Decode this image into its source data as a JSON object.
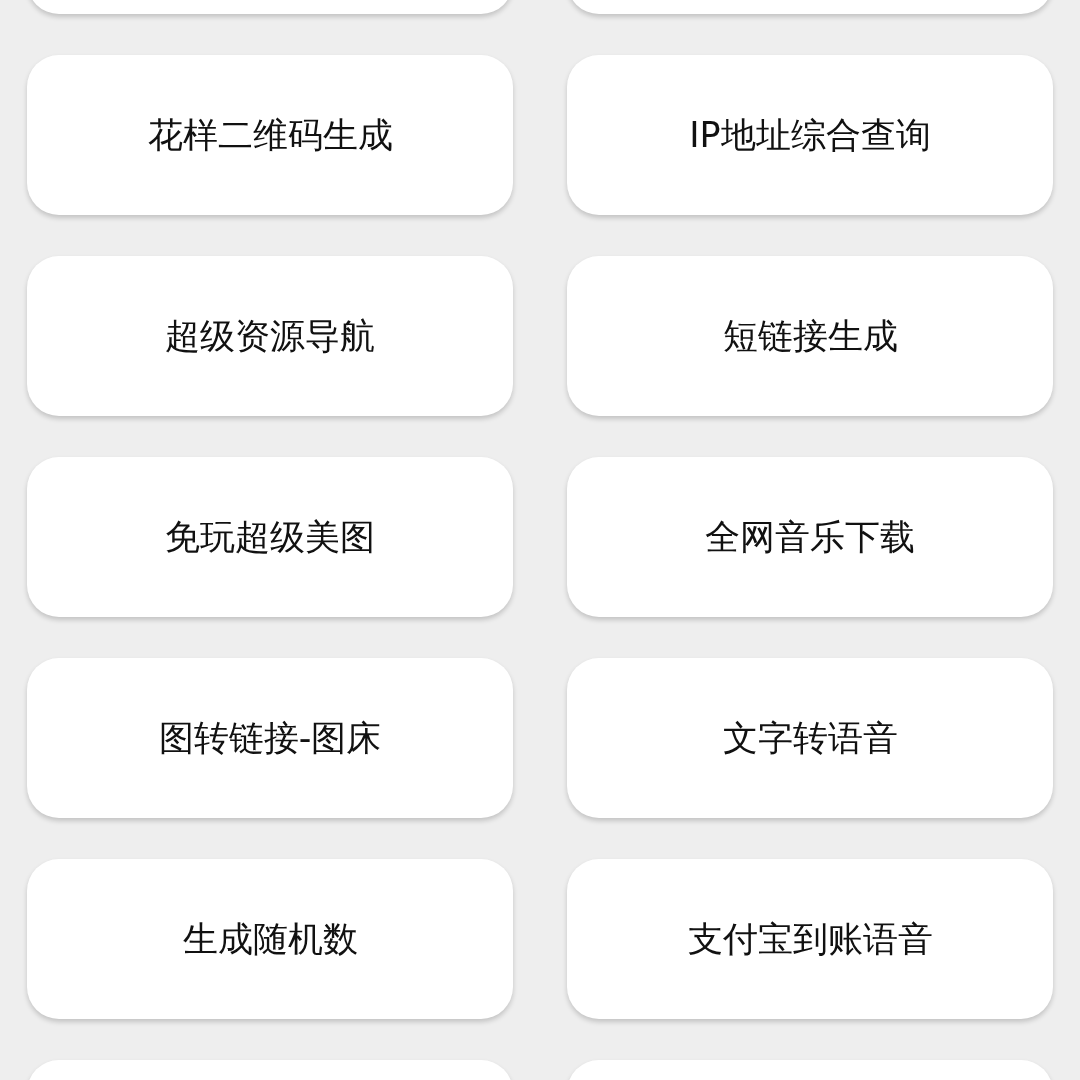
{
  "tools": [
    {
      "label": "花样二维码生成"
    },
    {
      "label": "IP地址综合查询"
    },
    {
      "label": "超级资源导航"
    },
    {
      "label": "短链接生成"
    },
    {
      "label": "免玩超级美图"
    },
    {
      "label": "全网音乐下载"
    },
    {
      "label": "图转链接-图床"
    },
    {
      "label": "文字转语音"
    },
    {
      "label": "生成随机数"
    },
    {
      "label": "支付宝到账语音"
    }
  ]
}
